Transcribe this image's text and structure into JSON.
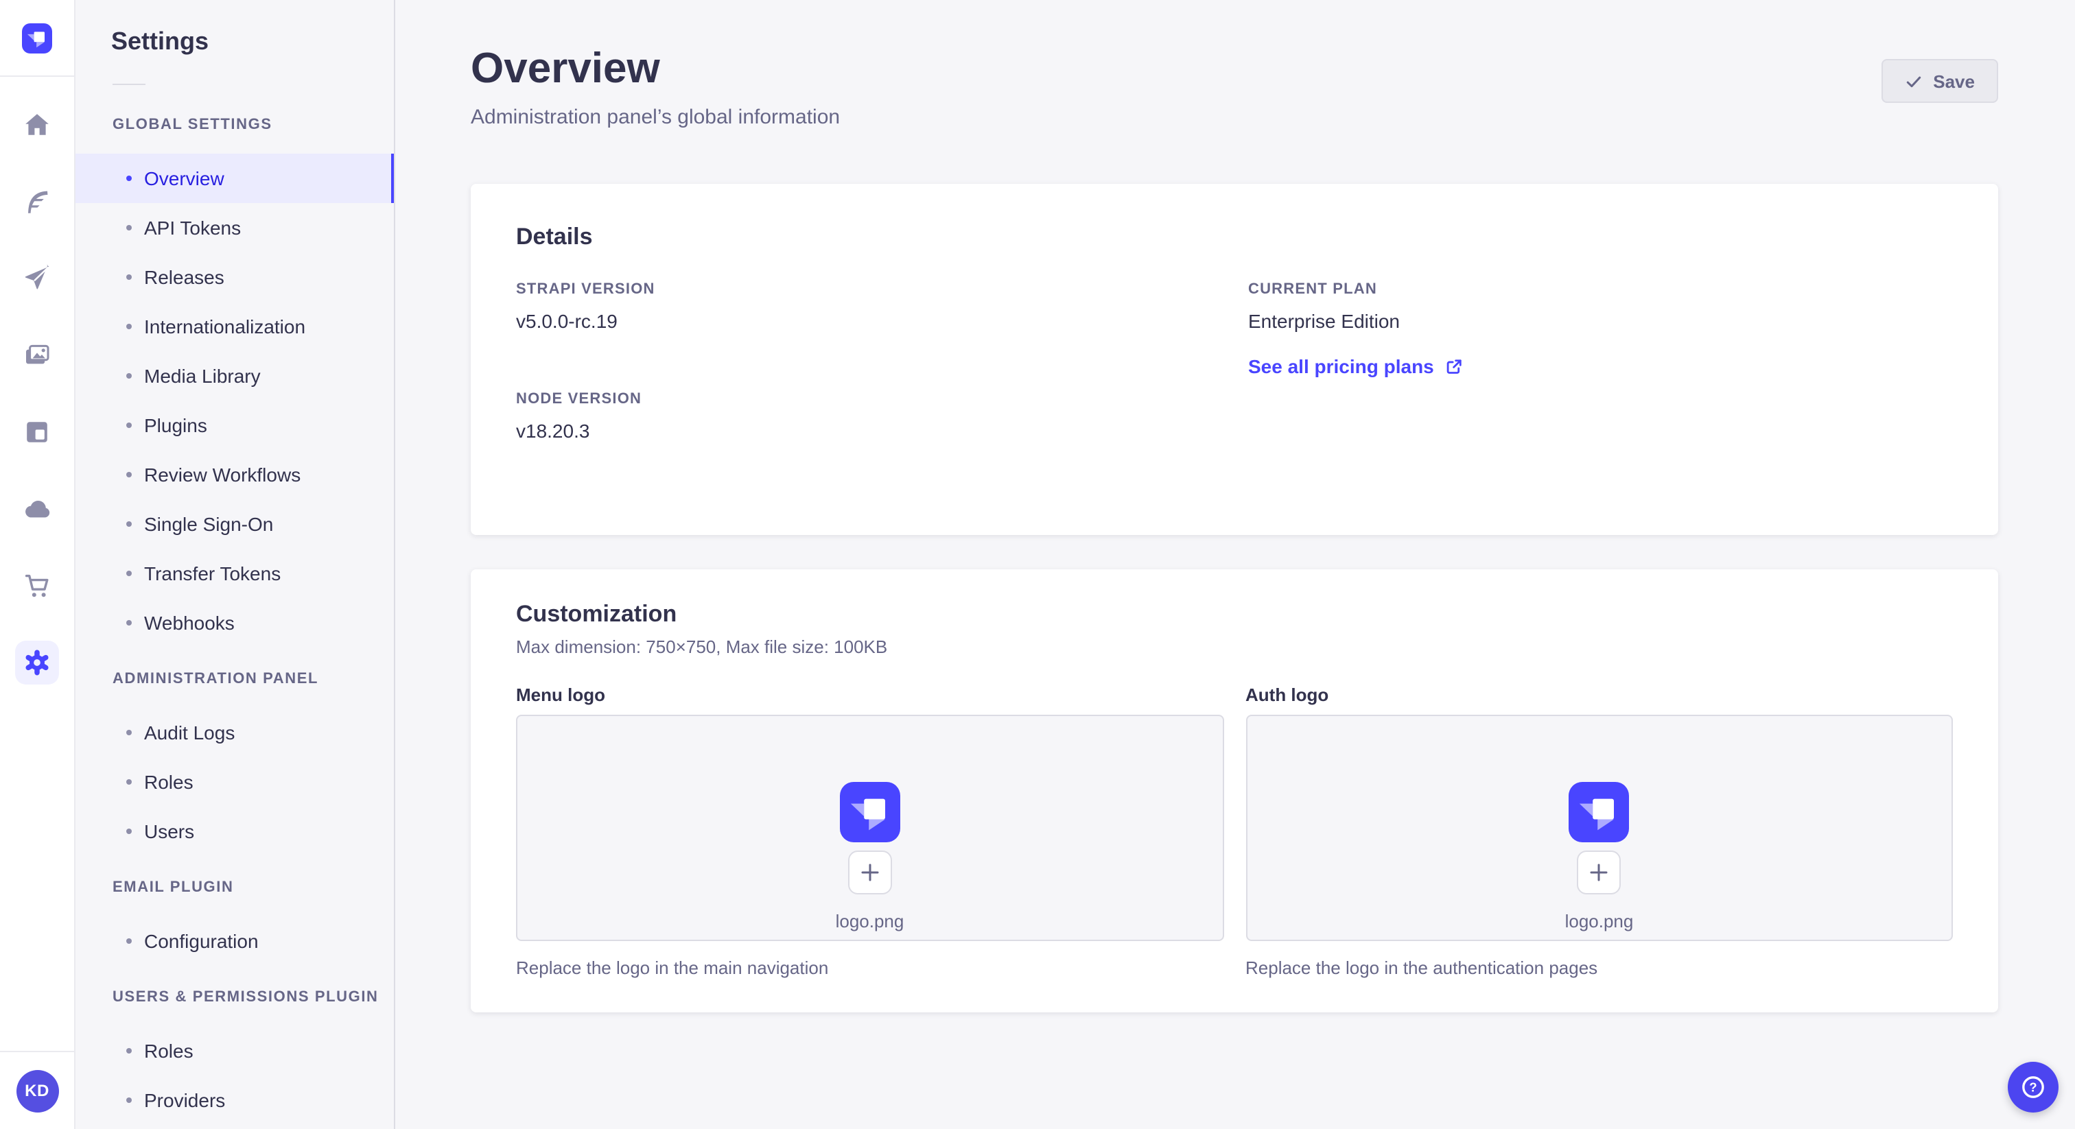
{
  "brand": {
    "primary": "#4945ff",
    "primary_dark": "#271fe0",
    "active_item_bg": "#ebebfe",
    "avatar_bg": "#554fe1"
  },
  "rail": {
    "avatar_initials": "KD"
  },
  "subnav": {
    "title": "Settings",
    "sections": [
      {
        "label": "GLOBAL SETTINGS",
        "items": [
          {
            "label": "Overview",
            "active": true
          },
          {
            "label": "API Tokens"
          },
          {
            "label": "Releases"
          },
          {
            "label": "Internationalization"
          },
          {
            "label": "Media Library"
          },
          {
            "label": "Plugins"
          },
          {
            "label": "Review Workflows"
          },
          {
            "label": "Single Sign-On"
          },
          {
            "label": "Transfer Tokens"
          },
          {
            "label": "Webhooks"
          }
        ]
      },
      {
        "label": "ADMINISTRATION PANEL",
        "items": [
          {
            "label": "Audit Logs"
          },
          {
            "label": "Roles"
          },
          {
            "label": "Users"
          }
        ]
      },
      {
        "label": "EMAIL PLUGIN",
        "items": [
          {
            "label": "Configuration"
          }
        ]
      },
      {
        "label": "USERS & PERMISSIONS PLUGIN",
        "items": [
          {
            "label": "Roles"
          },
          {
            "label": "Providers"
          }
        ]
      }
    ]
  },
  "header": {
    "title": "Overview",
    "subtitle": "Administration panel’s global information",
    "save_label": "Save"
  },
  "details": {
    "title": "Details",
    "strapi_version_label": "STRAPI VERSION",
    "strapi_version": "v5.0.0-rc.19",
    "node_version_label": "NODE VERSION",
    "node_version": "v18.20.3",
    "plan_label": "CURRENT PLAN",
    "plan": "Enterprise Edition",
    "pricing_link_label": "See all pricing plans"
  },
  "customization": {
    "title": "Customization",
    "subtitle": "Max dimension: 750×750, Max file size: 100KB",
    "menu_logo": {
      "label": "Menu logo",
      "filename": "logo.png",
      "caption": "Replace the logo in the main navigation"
    },
    "auth_logo": {
      "label": "Auth logo",
      "filename": "logo.png",
      "caption": "Replace the logo in the authentication pages"
    }
  }
}
